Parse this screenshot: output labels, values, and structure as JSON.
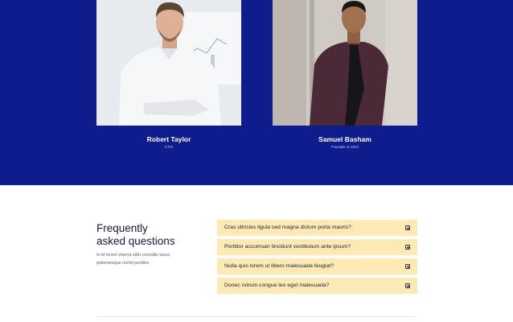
{
  "team": {
    "members": [
      {
        "name": "Robert Taylor",
        "role": "CTO"
      },
      {
        "name": "Samuel Basham",
        "role": "Founder & CEO"
      }
    ]
  },
  "faq": {
    "title_line1": "Frequently",
    "title_line2": "asked questions",
    "description": "In et lorem viverra nibh convallis lacus pellentesque morbi porttitor.",
    "items": [
      {
        "question": "Cras ultricies ligula sed magna dictum porta mauris?"
      },
      {
        "question": "Porttitor accumsan tincidunt vestibulum ante ipsum?"
      },
      {
        "question": "Nulla quis lorem ut libero malesuada feugiat?"
      },
      {
        "question": "Donec rutrum congue leo eget malesuada?"
      }
    ]
  },
  "colors": {
    "team_background": "#0e1c8c",
    "faq_item_background": "#fde9b4",
    "heading_text": "#141a3c"
  },
  "icons": {
    "faq_toggle": "plus-square-icon"
  }
}
